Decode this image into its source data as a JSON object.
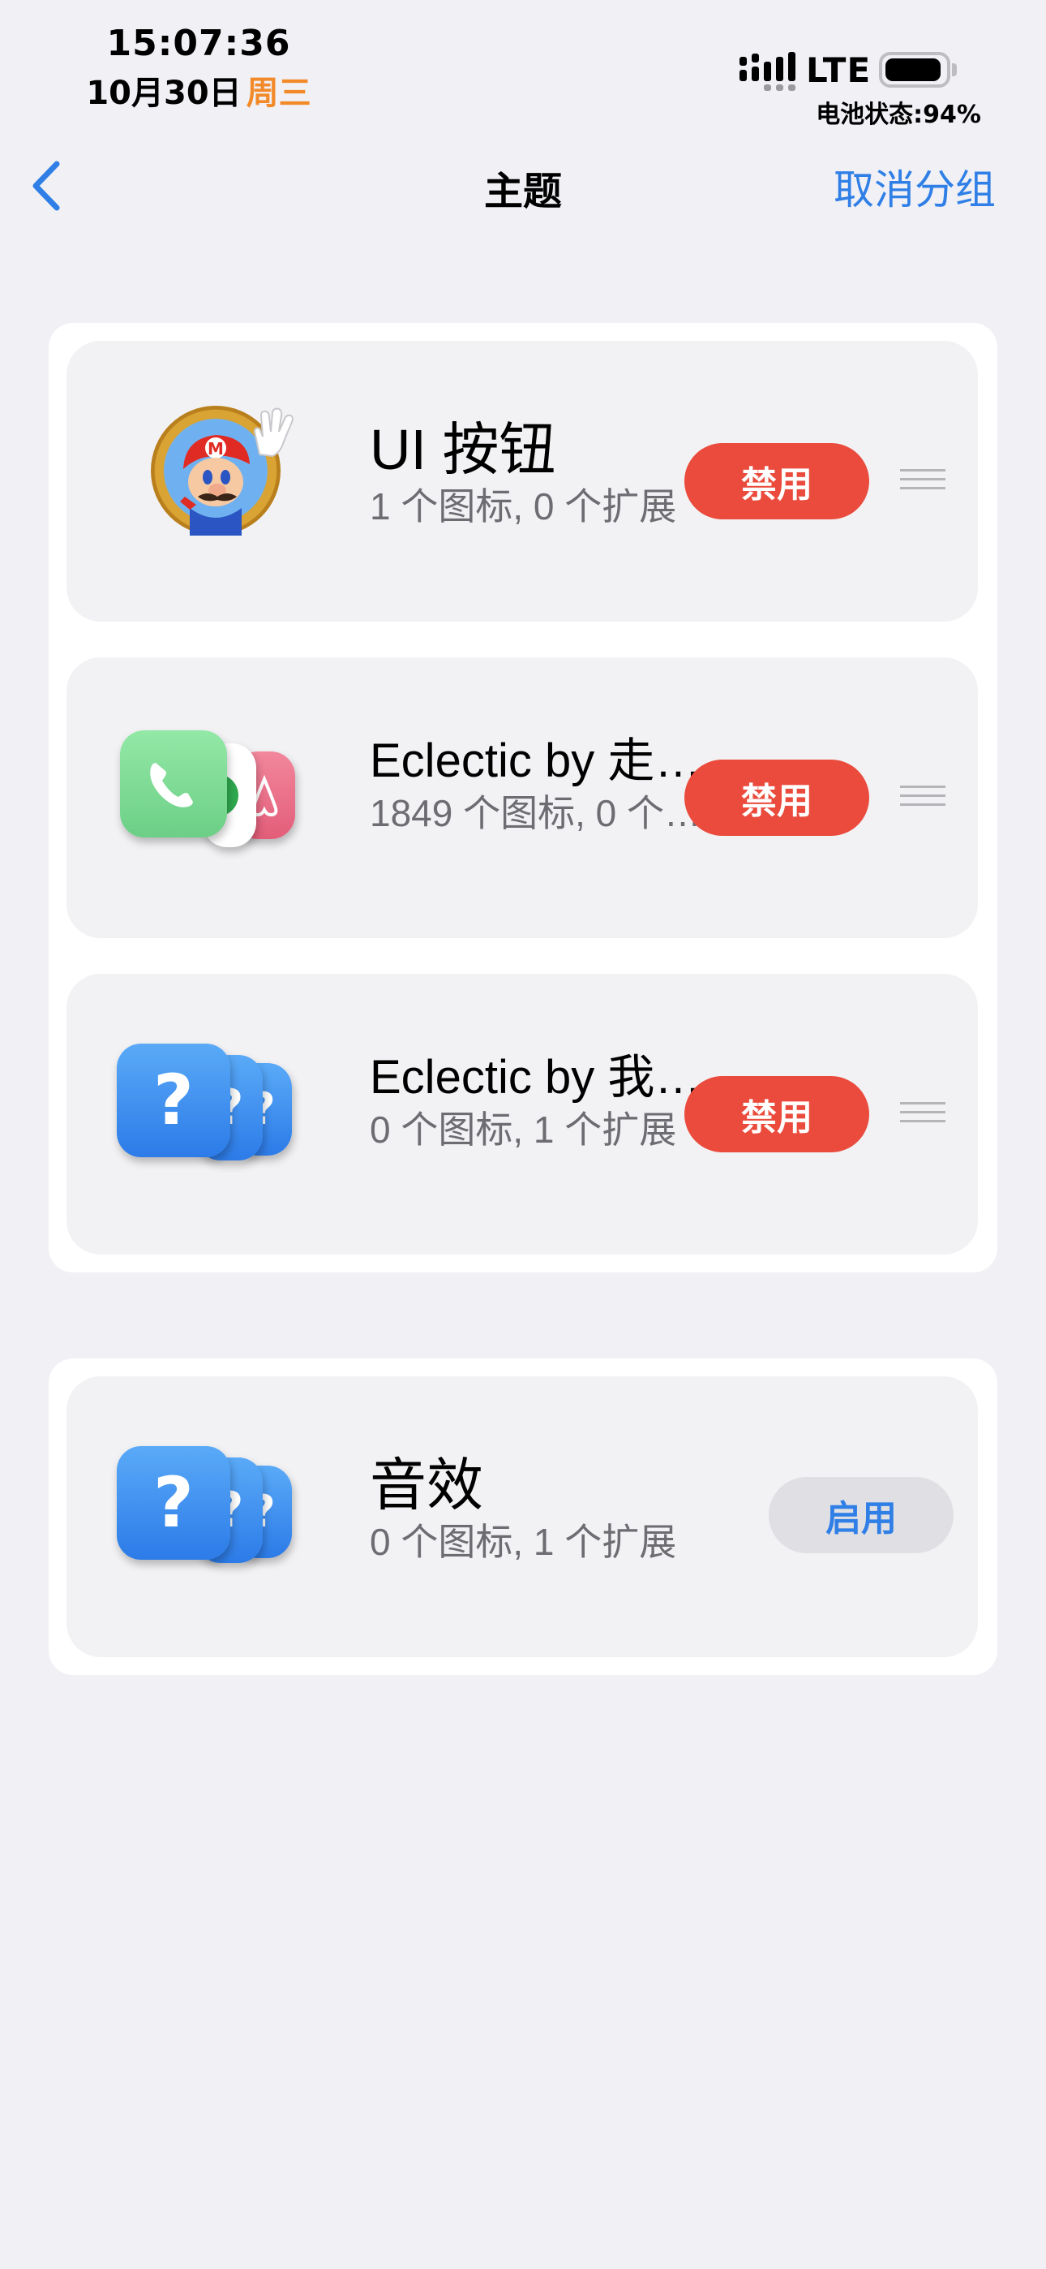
{
  "status_bar": {
    "time": "15:07:36",
    "date": "10月30日",
    "weekday": "周三",
    "network": "LTE",
    "battery_text": "电池状态:94%",
    "battery_level": 0.94
  },
  "nav": {
    "title": "主题",
    "action": "取消分组"
  },
  "groups": [
    {
      "items": [
        {
          "name": "UI 按钮",
          "subtitle": "1 个图标, 0 个扩展",
          "button": "禁用",
          "icon": "mario-icon"
        },
        {
          "name": "Eclectic by 走…",
          "subtitle": "1849 个图标, 0 个…",
          "button": "禁用",
          "icon": "phone-app-stack-icon"
        },
        {
          "name": "Eclectic by 我…",
          "subtitle": "0 个图标, 1 个扩展",
          "button": "禁用",
          "icon": "question-mark-stack-icon"
        }
      ]
    },
    {
      "items": [
        {
          "name": "音效",
          "subtitle": "0 个图标, 1 个扩展",
          "button": "启用",
          "icon": "question-mark-stack-icon"
        }
      ]
    }
  ],
  "glyphs": {
    "question": "?"
  },
  "colors": {
    "background": "#f0f0f5",
    "accent": "#2f7fe6",
    "disable_button": "#ea4b3c",
    "enable_button_bg": "#dfdfe4",
    "weekday": "#f28a2a"
  }
}
